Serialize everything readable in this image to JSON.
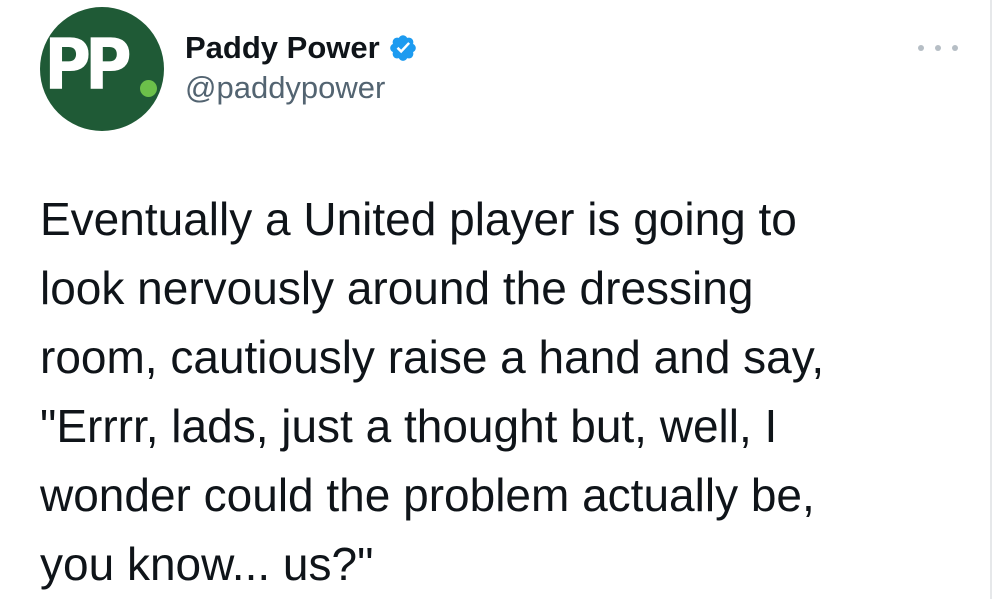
{
  "author": {
    "avatar_text": "PP",
    "avatar_color": "#1f5a36",
    "avatar_dot_color": "#6cc04a",
    "display_name": "Paddy Power",
    "verified": true,
    "verified_icon": "verified-badge-icon",
    "verified_color": "#1d9bf0",
    "handle": "@paddypower"
  },
  "menu": {
    "icon": "more-options-icon"
  },
  "tweet": {
    "text": "Eventually a United player is going to\nlook nervously around the dressing\nroom, cautiously raise a hand and say,\n\"Errrr, lads, just a thought but, well, I\nwonder could the problem actually be,\nyou know... us?\""
  }
}
